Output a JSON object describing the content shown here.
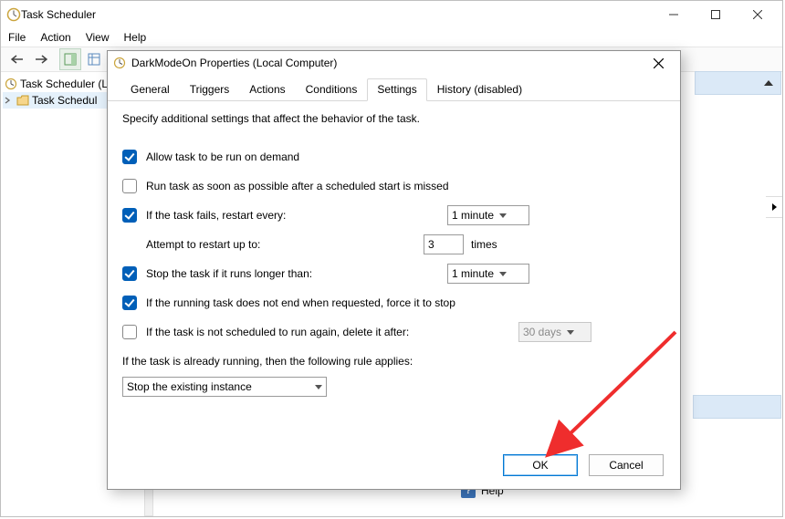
{
  "window": {
    "title": "Task Scheduler",
    "menu": {
      "file": "File",
      "action": "Action",
      "view": "View",
      "help": "Help"
    }
  },
  "tree": {
    "root": "Task Scheduler (L",
    "child": "Task Schedul"
  },
  "right_pane": {
    "help_label": "Help"
  },
  "dialog": {
    "title": "DarkModeOn Properties (Local Computer)",
    "tabs": {
      "general": "General",
      "triggers": "Triggers",
      "actions": "Actions",
      "conditions": "Conditions",
      "settings": "Settings",
      "history": "History (disabled)"
    },
    "settings": {
      "intro": "Specify additional settings that affect the behavior of the task.",
      "allow_on_demand": {
        "label": "Allow task to be run on demand",
        "checked": true
      },
      "run_asap": {
        "label": "Run task as soon as possible after a scheduled start is missed",
        "checked": false
      },
      "restart_if_fail": {
        "label": "If the task fails, restart every:",
        "checked": true,
        "interval": "1 minute"
      },
      "attempt_label": "Attempt to restart up to:",
      "attempt_count": "3",
      "attempt_suffix": "times",
      "stop_if_longer": {
        "label": "Stop the task if it runs longer than:",
        "checked": true,
        "value": "1 minute"
      },
      "force_stop": {
        "label": "If the running task does not end when requested, force it to stop",
        "checked": true
      },
      "delete_after": {
        "label": "If the task is not scheduled to run again, delete it after:",
        "checked": false,
        "value": "30 days"
      },
      "already_running": "If the task is already running, then the following rule applies:",
      "rule_value": "Stop the existing instance"
    },
    "buttons": {
      "ok": "OK",
      "cancel": "Cancel"
    }
  }
}
